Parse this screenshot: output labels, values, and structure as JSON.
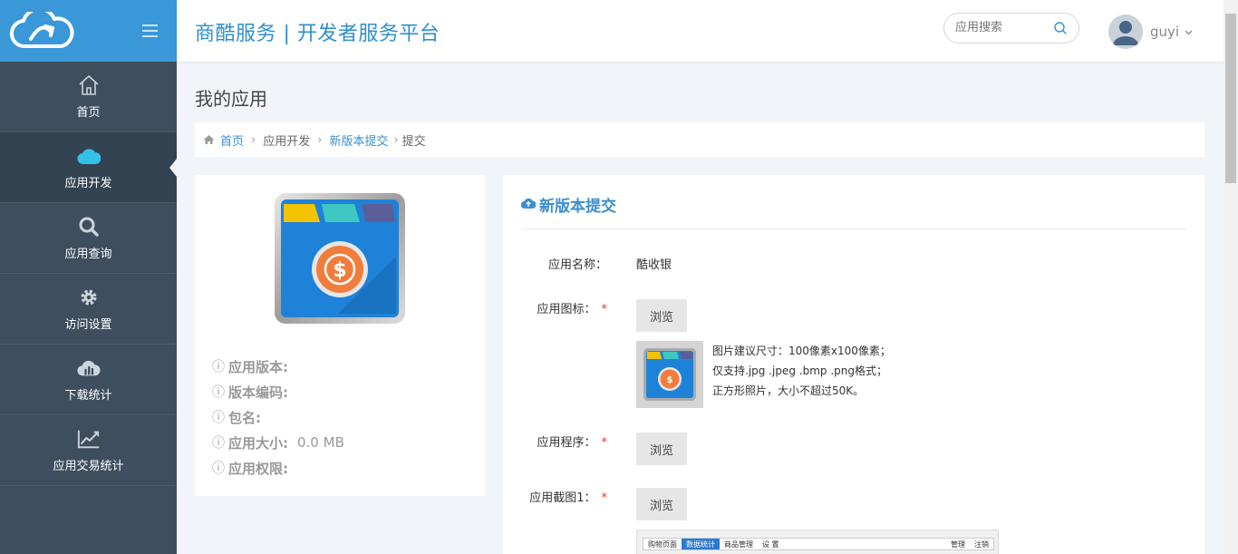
{
  "header": {
    "title": "商酷服务 | 开发者服务平台",
    "search_placeholder": "应用搜索",
    "username": "guyi"
  },
  "sidebar": {
    "items": [
      {
        "label": "首页",
        "icon": "home-icon"
      },
      {
        "label": "应用开发",
        "icon": "cloud-icon",
        "active": true
      },
      {
        "label": "应用查询",
        "icon": "search-icon"
      },
      {
        "label": "访问设置",
        "icon": "gear-icon"
      },
      {
        "label": "下载统计",
        "icon": "cloud-chart-icon"
      },
      {
        "label": "应用交易统计",
        "icon": "line-chart-icon"
      }
    ]
  },
  "page": {
    "title": "我的应用"
  },
  "breadcrumb": {
    "items": [
      "首页",
      "应用开发",
      "新版本提交",
      "提交"
    ]
  },
  "app_info": {
    "version_label": "应用版本:",
    "code_label": "版本编码:",
    "package_label": "包名:",
    "size_label": "应用大小:",
    "size_value": "0.0 MB",
    "permission_label": "应用权限:"
  },
  "form": {
    "title": "新版本提交",
    "name_label": "应用名称：",
    "name_value": "酷收银",
    "icon_label": "应用图标：",
    "program_label": "应用程序：",
    "screenshot_label": "应用截图1：",
    "required_mark": "*",
    "browse_label": "浏览",
    "hint_line1": "图片建议尺寸：100像素x100像素；",
    "hint_line2": "仅支持.jpg .jpeg .bmp .png格式；",
    "hint_line3": "正方形照片，大小不超过50K。"
  },
  "screenshot_preview": {
    "tabs": [
      "购物页面",
      "数据统计",
      "商品管理",
      "设 置"
    ],
    "right": [
      "管理",
      "注销"
    ]
  },
  "colors": {
    "accent": "#3a98d9",
    "sidebar": "#3e4e5e",
    "required": "#e0353a"
  }
}
